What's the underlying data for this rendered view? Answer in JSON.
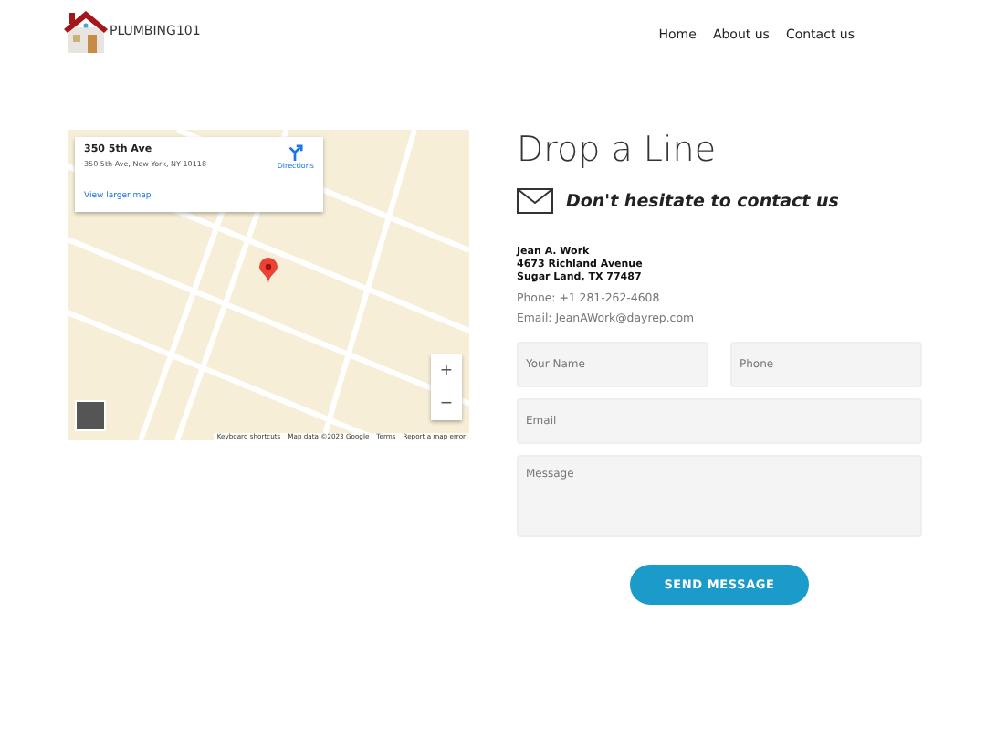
{
  "header": {
    "logo_text": "PLUMBING101",
    "nav": [
      {
        "label": "Home"
      },
      {
        "label": "About us"
      },
      {
        "label": "Contact us"
      }
    ]
  },
  "map": {
    "place_card": {
      "title": "350 5th Ave",
      "address": "350 5th Ave, New York, NY 10118",
      "directions": "Directions",
      "larger_map": "View larger map"
    },
    "zoom_in": "+",
    "zoom_out": "−",
    "footer": [
      "Keyboard shortcuts",
      "Map data ©2023 Google",
      "Terms",
      "Report a map error"
    ]
  },
  "contact": {
    "title": "Drop a Line",
    "subtitle": "Don't hesitate to contact us",
    "address_lines": [
      "Jean A. Work",
      "4673 Richland Avenue",
      "Sugar Land, TX 77487"
    ],
    "phone": "Phone: +1 281-262-4608",
    "email": "Email: JeanAWork@dayrep.com"
  },
  "form": {
    "fields": [
      {
        "kind": "input",
        "placeholder": "Your Name"
      },
      {
        "kind": "input",
        "placeholder": "Phone"
      },
      {
        "kind": "input",
        "placeholder": "Email"
      },
      {
        "kind": "textarea",
        "placeholder": "Message"
      }
    ],
    "submit": "SEND MESSAGE"
  }
}
